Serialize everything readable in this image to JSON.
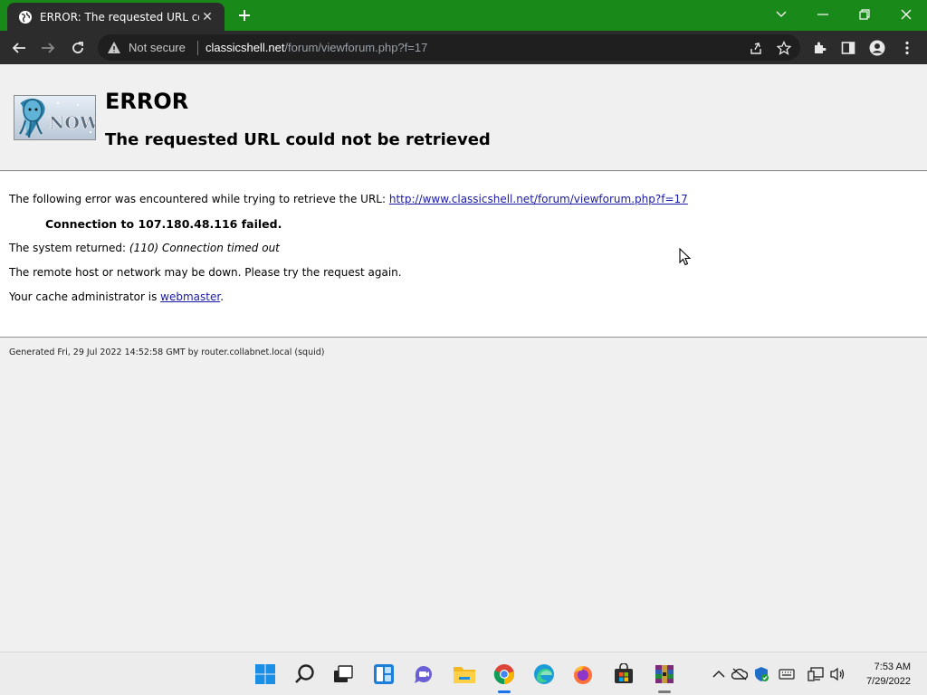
{
  "browser": {
    "tab_title": "ERROR: The requested URL could",
    "tab_close": "✕",
    "omnibox": {
      "security_label": "Not secure",
      "url_host": "classicshell.net",
      "url_path": "/forum/viewforum.php?f=17"
    },
    "accent_color": "#198a19"
  },
  "page": {
    "title": "ERROR",
    "subtitle": "The requested URL could not be retrieved",
    "logo_text": "NOW",
    "intro_text": "The following error was encountered while trying to retrieve the URL: ",
    "intro_link": "http://www.classicshell.net/forum/viewforum.php?f=17",
    "connection_failed": "Connection to 107.180.48.116 failed.",
    "system_returned_label": "The system returned: ",
    "system_returned_value": "(110) Connection timed out",
    "remote_host_text": "The remote host or network may be down. Please try the request again.",
    "cache_admin_text": "Your cache administrator is ",
    "cache_admin_link": "webmaster",
    "cache_admin_end": ".",
    "generated_text": "Generated Fri, 29 Jul 2022 14:52:58 GMT by router.collabnet.local (squid)"
  },
  "taskbar": {
    "apps": [
      "start",
      "search",
      "task-view",
      "widgets",
      "teams-chat",
      "file-explorer",
      "chrome",
      "edge",
      "firefox",
      "microsoft-store",
      "winrar"
    ],
    "clock_time": "7:53 AM",
    "clock_date": "7/29/2022"
  }
}
